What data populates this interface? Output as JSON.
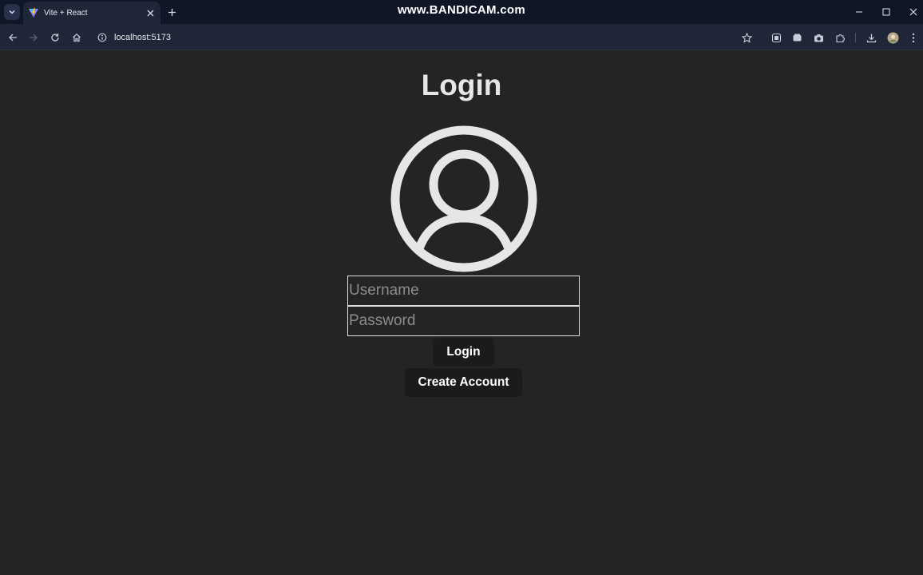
{
  "browser": {
    "tab_title": "Vite + React",
    "url": "localhost:5173",
    "watermark": "www.BANDICAM.com"
  },
  "page": {
    "title": "Login",
    "username_placeholder": "Username",
    "password_placeholder": "Password",
    "login_label": "Login",
    "create_account_label": "Create Account"
  },
  "colors": {
    "background": "#242424",
    "text": "#e6e6e6",
    "button_bg": "#1b1b1b",
    "chrome_bg": "#1e2638"
  },
  "icons": {
    "tab_list": "chevron-down-icon",
    "favicon": "vite-logo-icon",
    "tab_close": "close-icon",
    "new_tab": "plus-icon",
    "back": "arrow-left-icon",
    "forward": "arrow-right-icon",
    "reload": "reload-icon",
    "home": "home-icon",
    "site_info": "info-icon",
    "bookmark": "star-icon",
    "extensions": "puzzle-icon",
    "downloads": "download-icon",
    "profile": "avatar-icon",
    "menu": "kebab-menu-icon",
    "user_avatar": "user-circle-icon"
  }
}
